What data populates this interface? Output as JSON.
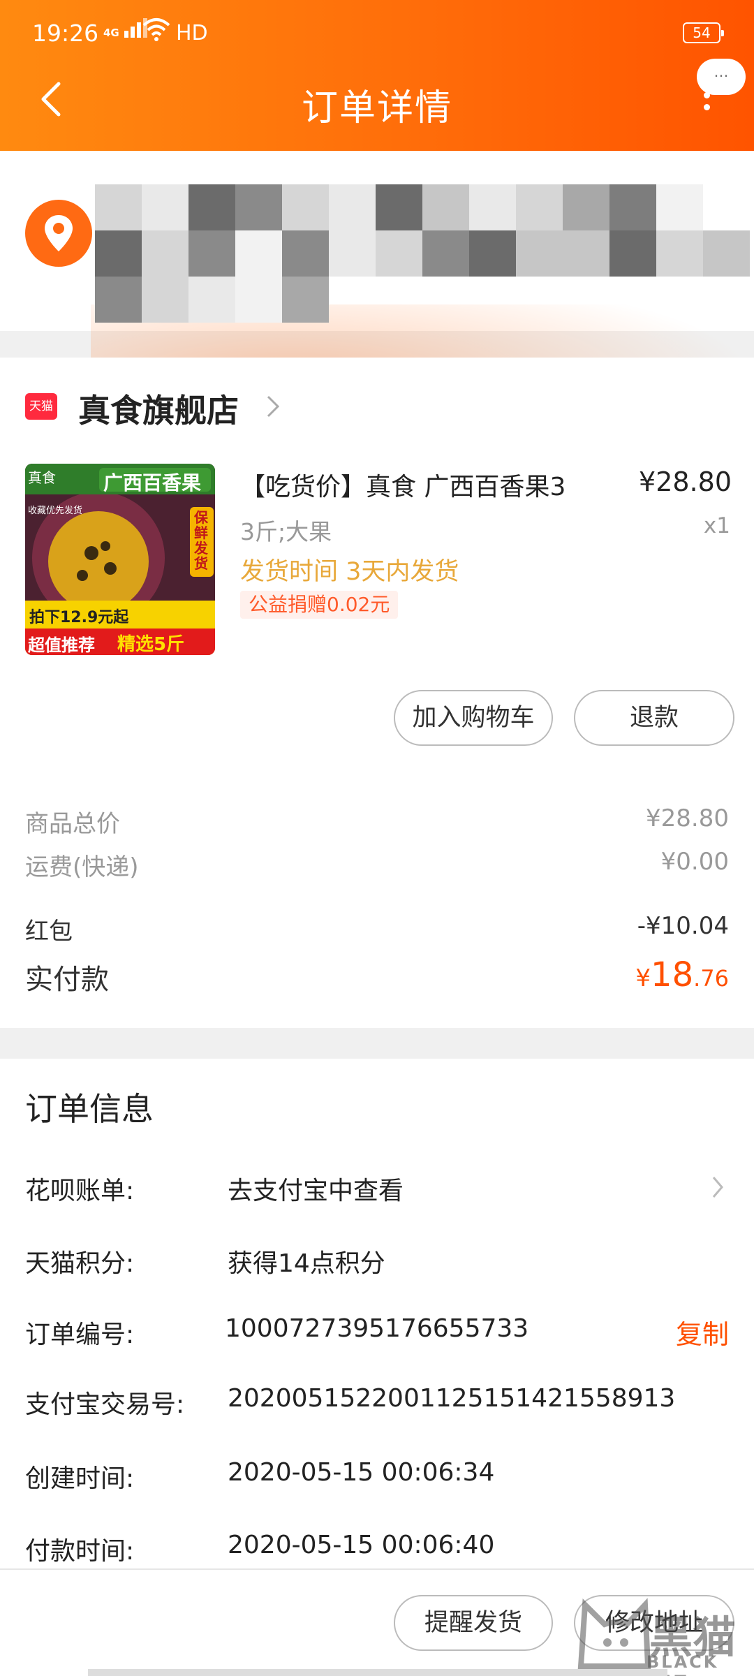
{
  "status_bar": {
    "time": "19:26",
    "network": "4G",
    "hd": "HD",
    "battery": "54"
  },
  "nav": {
    "title": "订单详情",
    "more_bubble": "..."
  },
  "shop": {
    "badge": "天猫",
    "name": "真食旗舰店"
  },
  "product": {
    "title": "【吃货价】真食 广西百香果3",
    "price": "¥28.80",
    "spec": "3斤;大果",
    "qty": "x1",
    "shipping": "发货时间 3天内发货",
    "charity": "公益捐赠0.02元",
    "image_text": {
      "brand": "真食",
      "banner": "广西百香果",
      "side_tag": "保鲜发货",
      "promo": "拍下12.9元起",
      "bottom_left": "超值推荐",
      "bottom_right": "精选5斤",
      "corner": "收藏优先发货"
    }
  },
  "buttons": {
    "add_to_cart": "加入购物车",
    "refund": "退款",
    "remind_ship": "提醒发货",
    "modify_address": "修改地址"
  },
  "summary": {
    "goods_total_label": "商品总价",
    "goods_total_value": "¥28.80",
    "shipping_label": "运费(快递)",
    "shipping_value": "¥0.00",
    "red_packet_label": "红包",
    "red_packet_value": "-¥10.04",
    "paid_label": "实付款",
    "paid_currency": "¥",
    "paid_int": "18",
    "paid_dec": ".76"
  },
  "order_info": {
    "title": "订单信息",
    "huabei_label": "花呗账单:",
    "huabei_value": "去支付宝中查看",
    "points_label": "天猫积分:",
    "points_value": "获得14点积分",
    "order_no_label": "订单编号:",
    "order_no_value": "1000727395176655733",
    "copy_label": "复制",
    "alipay_label": "支付宝交易号:",
    "alipay_value": "2020051522001125151421558913",
    "created_label": "创建时间:",
    "created_value": "2020-05-15 00:06:34",
    "paid_time_label": "付款时间:",
    "paid_time_value": "2020-05-15 00:06:40"
  },
  "watermark": {
    "text": "黑猫",
    "sub": "BLACK CAT"
  },
  "colors": {
    "header_start": "#ff8a10",
    "header_end": "#ff5400",
    "accent": "#ff5000",
    "ship_text": "#e8a83a"
  }
}
